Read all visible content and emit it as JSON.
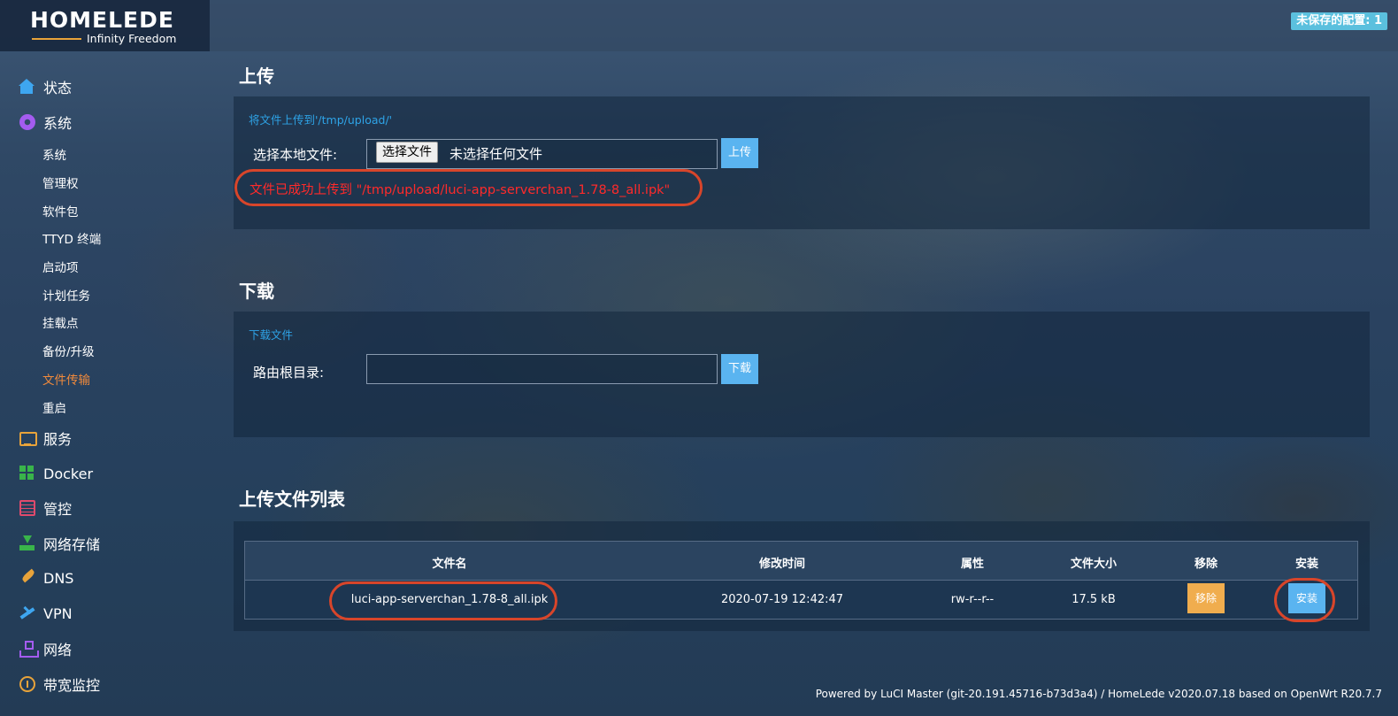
{
  "header": {
    "logo_main": "HOMELEDE",
    "logo_sub": "Infinity Freedom",
    "unsaved": "未保存的配置: 1"
  },
  "sidebar": {
    "top_items": [
      {
        "label": "状态",
        "icon": "home-icon"
      },
      {
        "label": "系统",
        "icon": "gear-icon"
      },
      {
        "label": "服务",
        "icon": "service-icon"
      },
      {
        "label": "Docker",
        "icon": "docker-icon"
      },
      {
        "label": "管控",
        "icon": "control-icon"
      },
      {
        "label": "网络存储",
        "icon": "download-icon"
      },
      {
        "label": "DNS",
        "icon": "rocket-icon"
      },
      {
        "label": "VPN",
        "icon": "plane-icon"
      },
      {
        "label": "网络",
        "icon": "network-icon"
      },
      {
        "label": "带宽监控",
        "icon": "info-icon"
      }
    ],
    "sub_items": [
      {
        "label": "系统"
      },
      {
        "label": "管理权"
      },
      {
        "label": "软件包"
      },
      {
        "label": "TTYD 终端"
      },
      {
        "label": "启动项"
      },
      {
        "label": "计划任务"
      },
      {
        "label": "挂载点"
      },
      {
        "label": "备份/升级"
      },
      {
        "label": "文件传输",
        "active": true
      },
      {
        "label": "重启"
      }
    ]
  },
  "upload": {
    "title": "上传",
    "legend": "将文件上传到'/tmp/upload/'",
    "label": "选择本地文件:",
    "choose_button": "选择文件",
    "no_file": "未选择任何文件",
    "upload_button": "上传",
    "success_message": "文件已成功上传到 \"/tmp/upload/luci-app-serverchan_1.78-8_all.ipk\""
  },
  "download": {
    "title": "下载",
    "legend": "下载文件",
    "label": "路由根目录:",
    "path_value": "",
    "download_button": "下载"
  },
  "file_list": {
    "title": "上传文件列表",
    "columns": [
      "文件名",
      "修改时间",
      "属性",
      "文件大小",
      "移除",
      "安装"
    ],
    "rows": [
      {
        "name": "luci-app-serverchan_1.78-8_all.ipk",
        "mtime": "2020-07-19 12:42:47",
        "attr": "rw-r--r--",
        "size": "17.5 kB",
        "remove": "移除",
        "install": "安装"
      }
    ]
  },
  "footer": "Powered by LuCI Master (git-20.191.45716-b73d3a4) / HomeLede v2020.07.18 based on OpenWrt R20.7.7",
  "colors": {
    "accent_blue": "#5ab4f0",
    "active_orange": "#f08a3c",
    "error_red": "#ff2a2a",
    "warning": "#f0ad4e",
    "unsaved_badge": "#5bc0de"
  }
}
